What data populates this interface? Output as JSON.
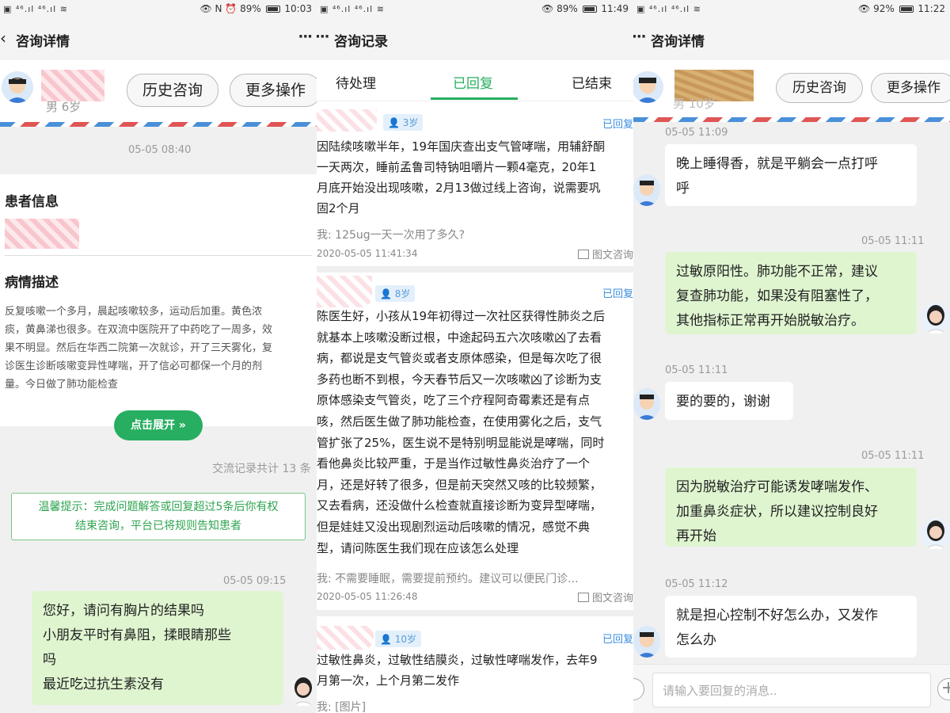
{
  "p1": {
    "status_left": "▣ ⁴⁶.ıl ⁴⁶.ıl ≋",
    "status_right": "👁 N ⏰ 89%",
    "time": "10:03",
    "nav_title": "咨询详情",
    "nav_more": "···",
    "history_btn": "历史咨询",
    "more_btn": "更多操作",
    "patient_sub": "男 6岁",
    "start_time": "05-05 08:40",
    "patient_info_title": "患者信息",
    "condition_title": "病情描述",
    "condition_lines": [
      "反复咳嗽一个多月，晨起咳嗽较多，运动后加重。黄色浓",
      "痰，黄鼻涕也很多。在双流中医院开了中药吃了一周多，效",
      "果不明显。然后在华西二院第一次就诊，开了三天雾化，复",
      "诊医生诊断咳嗽变异性哮喘，开了信必可都保一个月的剂",
      "量。今日做了肺功能检查"
    ],
    "expand_btn": "点击展开 »",
    "record_count": "交流记录共计 13 条",
    "notice_lines": [
      "温馨提示：完成问题解答或回复超过5条后你有权",
      "结束咨询，平台已将规则告知患者"
    ],
    "msg_time": "05-05 09:15",
    "msg_lines": [
      "您好，请问有胸片的结果吗",
      "小朋友平时有鼻阻，揉眼睛那些",
      "吗",
      "最近吃过抗生素没有"
    ]
  },
  "p2": {
    "status_left": "▣ ⁴⁶.ıl ⁴⁶.ıl ≋",
    "status_right": "👁 89%",
    "time": "11:49",
    "nav_title": "咨询记录",
    "nav_more_left": "···",
    "tabs": [
      "待处理",
      "已回复",
      "已结束"
    ],
    "items": [
      {
        "age": "3岁",
        "status": "已回复",
        "lines": [
          "因陆续咳嗽半年，19年国庆查出支气管哮喘，用辅舒酮",
          "一天两次，睡前孟鲁司特钠咀嚼片一颗4毫克，20年1",
          "月底开始没出现咳嗽，2月13做过线上咨询，说需要巩",
          "固2个月"
        ],
        "answer": "我: 125ug一天一次用了多久?",
        "datetime": "2020-05-05 11:41:34",
        "kind": "图文咨询"
      },
      {
        "age": "8岁",
        "status": "已回复",
        "lines": [
          "陈医生好，小孩从19年初得过一次社区获得性肺炎之后",
          "就基本上咳嗽没断过根，中途起码五六次咳嗽凶了去看",
          "病，都说是支气管炎或者支原体感染，但是每次吃了很",
          "多药也断不到根，今天春节后又一次咳嗽凶了诊断为支",
          "原体感染支气管炎，吃了三个疗程阿奇霉素还是有点",
          "咳，然后医生做了肺功能检查，在使用雾化之后，支气",
          "管扩张了25%，医生说不是特别明显能说是哮喘，同时",
          "看他鼻炎比较严重，于是当作过敏性鼻炎治疗了一个",
          "月，还是好转了很多，但是前天突然又咳的比较频繁，",
          "又去看病，还没做什么检查就直接诊断为变异型哮喘，",
          "但是娃娃又没出现剧烈运动后咳嗽的情况，感觉不典",
          "型，请问陈医生我们现在应该怎么处理"
        ],
        "answer": "我: 不需要睡眠，需要提前预约。建议可以便民门诊...",
        "datetime": "2020-05-05 11:26:48",
        "kind": "图文咨询"
      },
      {
        "age": "10岁",
        "status": "已回复",
        "lines": [
          "过敏性鼻炎，过敏性结膜炎，过敏性哮喘发作，去年9",
          "月第一次，上个月第二发作"
        ],
        "answer": "我: [图片]",
        "datetime": "",
        "kind": ""
      }
    ]
  },
  "p3": {
    "status_left": "▣ ⁴⁶.ıl ⁴⁶.ıl ≋",
    "status_right": "👁 92%",
    "time": "11:22",
    "nav_title": "咨询详情",
    "nav_more_left": "···",
    "history_btn": "历史咨询",
    "more_btn": "更多操作",
    "patient_sub": "男 10岁",
    "messages": [
      {
        "time": "05-05 11:09",
        "from": "patient",
        "lines": [
          "晚上睡得香，就是平躺会一点打呼",
          "呼"
        ]
      },
      {
        "time": "05-05 11:11",
        "from": "doctor",
        "lines": [
          "过敏原阳性。肺功能不正常，建议",
          "复查肺功能，如果没有阻塞性了，",
          "其他指标正常再开始脱敏治疗。"
        ]
      },
      {
        "time": "05-05 11:11",
        "from": "patient",
        "lines": [
          "要的要的，谢谢"
        ]
      },
      {
        "time": "05-05 11:11",
        "from": "doctor",
        "lines": [
          "因为脱敏治疗可能诱发哮喘发作、",
          "加重鼻炎症状，所以建议控制良好",
          "再开始"
        ]
      },
      {
        "time": "05-05 11:12",
        "from": "patient",
        "lines": [
          "就是担心控制不好怎么办，又发作",
          "怎么办"
        ]
      }
    ],
    "input_placeholder": "请输入要回复的消息..",
    "plus": "+"
  }
}
